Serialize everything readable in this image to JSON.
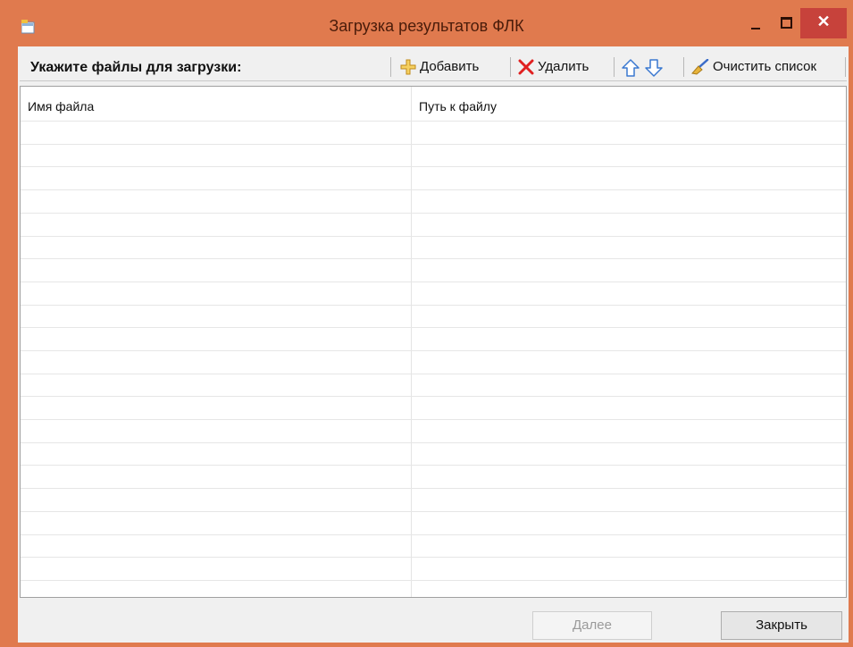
{
  "window": {
    "title": "Загрузка результатов ФЛК",
    "close_glyph": "✕"
  },
  "toolbar": {
    "label": "Укажите файлы для загрузки:",
    "add_label": "Добавить",
    "delete_label": "Удалить",
    "clear_label": "Очистить список"
  },
  "grid": {
    "columns": [
      "Имя файла",
      "Путь к файлу"
    ]
  },
  "footer": {
    "next_label": "Далее",
    "close_label": "Закрыть"
  },
  "icons": {
    "add": "plus-icon",
    "delete": "red-x-icon",
    "up": "arrow-up-icon",
    "down": "arrow-down-icon",
    "clear": "broom-icon"
  }
}
